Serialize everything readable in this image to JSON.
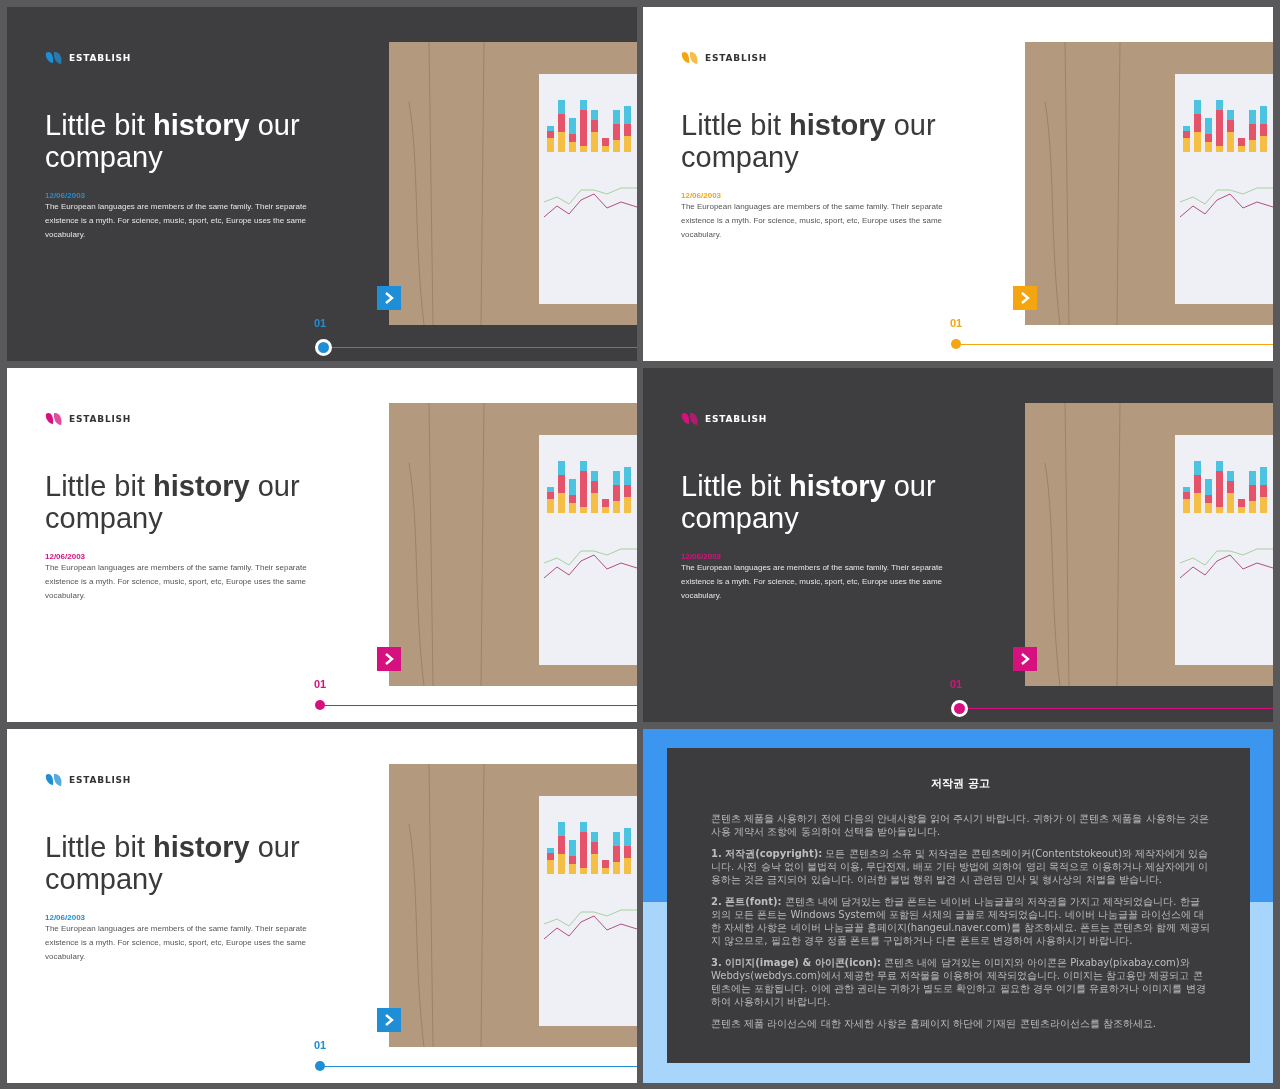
{
  "slides": [
    {
      "kind": "history",
      "dark": true,
      "color": "#1e8fd6",
      "logo": "ESTABLISH",
      "title": "Little bit **history** our company",
      "date": "12/06/2003",
      "body": "The European languages are members of the same family. Their separate existence is a myth. For science, music, sport, etc, Europe uses the same vocabulary.",
      "step": "01"
    },
    {
      "kind": "history",
      "dark": false,
      "color": "#f5a50f",
      "logo": "ESTABLISH",
      "title": "Little bit **history** our company",
      "date": "12/06/2003",
      "body": "The European languages are members of the same family. Their separate existence is a myth. For science, music, sport, etc, Europe uses the same vocabulary.",
      "step": "01"
    },
    {
      "kind": "history",
      "dark": false,
      "color": "#d6117f",
      "logo": "ESTABLISH",
      "title": "Little bit **history** our company",
      "date": "12/06/2003",
      "body": "The European languages are members of the same family. Their separate existence is a myth. For science, music, sport, etc, Europe uses the same vocabulary.",
      "step": "01"
    },
    {
      "kind": "history",
      "dark": true,
      "color": "#d6117f",
      "logo": "ESTABLISH",
      "title": "Little bit **history** our company",
      "date": "12/06/2003",
      "body": "The European languages are members of the same family. Their separate existence is a myth. For science, music, sport, etc, Europe uses the same vocabulary.",
      "step": "01"
    },
    {
      "kind": "history",
      "dark": false,
      "color": "#1e8fd6",
      "logo": "ESTABLISH",
      "title": "Little bit **history** our company",
      "date": "12/06/2003",
      "body": "The European languages are members of the same family. Their separate existence is a myth. For science, music, sport, etc, Europe uses the same vocabulary.",
      "step": "01"
    },
    {
      "kind": "notice",
      "title": "저작권 공고",
      "paragraphs": [
        "콘텐츠 제품을 사용하기 전에 다음의 안내사항을 읽어 주시기 바랍니다. 귀하가 이 콘텐츠 제품을 사용하는 것은 사용 계약서 조항에 동의하여 선택을 받아들입니다.",
        "**1. 저작권(copyright):** 모든 콘텐츠의 소유 및 저작권은 콘텐츠메이커(Contentstokeout)와 제작자에게 있습니다. 사전 승낙 없이 불법적 이용, 무단전재, 배포 기타 방법에 의하여 영리 목적으로 이용하거나 제삼자에게 이용하는 것은 금지되어 있습니다. 이러한 불법 행위 발견 시 관련된 민사 및 형사상의 처벌을 받습니다.",
        "**2. 폰트(font):** 콘텐츠 내에 담겨있는 한글 폰트는 네이버 나눔글꼴의 저작권을 가지고 제작되었습니다. 한글 외의 모든 폰트는 Windows System에 포함된 서체의 글꼴로 제작되었습니다. 네이버 나눔글꼴 라이선스에 대한 자세한 사항은 네이버 나눔글꼴 홈페이지(hangeul.naver.com)를 참조하세요. 폰트는 콘텐츠와 함께 제공되지 않으므로, 필요한 경우 정품 폰트를 구입하거나 다른 폰트로 변경하여 사용하시기 바랍니다.",
        "**3. 이미지(image) & 아이콘(icon):** 콘텐츠 내에 담겨있는 이미지와 아이콘은 Pixabay(pixabay.com)와 Webdys(webdys.com)에서 제공한 무료 저작물을 이용하여 제작되었습니다. 이미지는 참고용만 제공되고 콘텐츠에는 포함됩니다. 이에 관한 권리는 귀하가 별도로 확인하고 필요한 경우 여기를 유료하거나 이미지를 변경하여 사용하시기 바랍니다.",
        "콘텐츠 제품 라이선스에 대한 자세한 사항은 홈페이지 하단에 기재된 콘텐츠라이선스를 참조하세요."
      ]
    }
  ]
}
